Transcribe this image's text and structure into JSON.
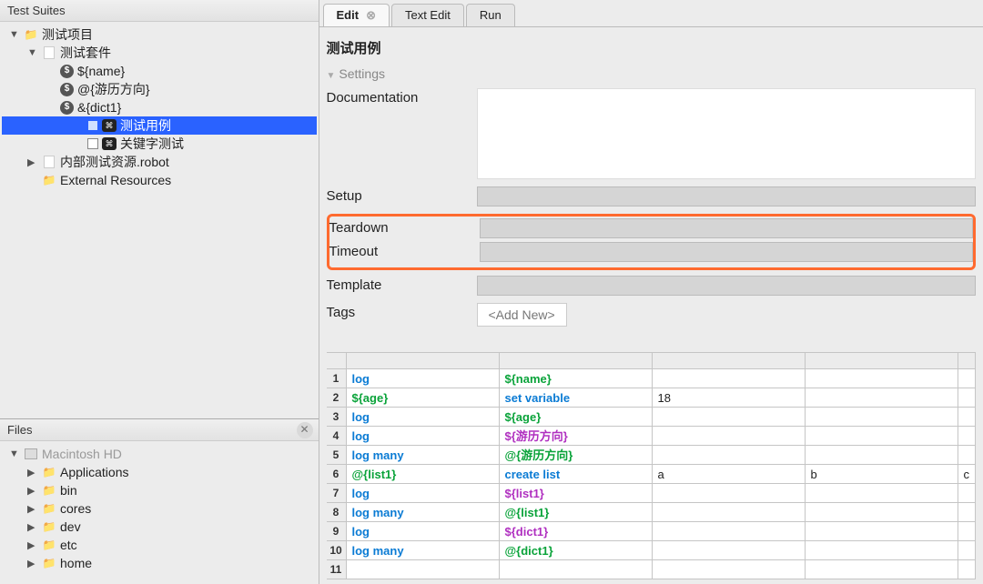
{
  "left": {
    "suites_title": "Test Suites",
    "files_title": "Files",
    "tree": [
      {
        "indent": 0,
        "expander": "▼",
        "icons": [
          "folder-open"
        ],
        "label": "测试项目"
      },
      {
        "indent": 1,
        "expander": "▼",
        "icons": [
          "file"
        ],
        "label": "测试套件"
      },
      {
        "indent": 2,
        "expander": "",
        "icons": [
          "var"
        ],
        "label": "${name}"
      },
      {
        "indent": 2,
        "expander": "",
        "icons": [
          "var"
        ],
        "label": "@{游历方向}"
      },
      {
        "indent": 2,
        "expander": "",
        "icons": [
          "var"
        ],
        "label": "&{dict1}"
      },
      {
        "indent": 2,
        "expander": "",
        "icons": [
          "checkbox",
          "kw"
        ],
        "label": "测试用例",
        "selected": true,
        "offset": true
      },
      {
        "indent": 2,
        "expander": "",
        "icons": [
          "checkbox",
          "kw"
        ],
        "label": "关键字测试",
        "offset": true
      },
      {
        "indent": 1,
        "expander": "▶",
        "icons": [
          "file"
        ],
        "label": "内部测试资源.robot"
      },
      {
        "indent": 1,
        "expander": "",
        "icons": [
          "folder-open"
        ],
        "label": "External Resources"
      }
    ],
    "files_tree": [
      {
        "indent": 0,
        "expander": "▼",
        "icons": [
          "disk"
        ],
        "label": "Macintosh HD",
        "grey": true
      },
      {
        "indent": 1,
        "expander": "▶",
        "icons": [
          "folder"
        ],
        "label": "Applications"
      },
      {
        "indent": 1,
        "expander": "▶",
        "icons": [
          "folder"
        ],
        "label": "bin"
      },
      {
        "indent": 1,
        "expander": "▶",
        "icons": [
          "folder"
        ],
        "label": "cores"
      },
      {
        "indent": 1,
        "expander": "▶",
        "icons": [
          "folder"
        ],
        "label": "dev"
      },
      {
        "indent": 1,
        "expander": "▶",
        "icons": [
          "folder"
        ],
        "label": "etc"
      },
      {
        "indent": 1,
        "expander": "▶",
        "icons": [
          "folder"
        ],
        "label": "home"
      }
    ]
  },
  "tabs": [
    {
      "label": "Edit",
      "active": true,
      "closable": true
    },
    {
      "label": "Text Edit",
      "active": false
    },
    {
      "label": "Run",
      "active": false
    }
  ],
  "editor": {
    "title": "测试用例",
    "settings_header": "Settings",
    "rows": {
      "documentation": "Documentation",
      "setup": "Setup",
      "teardown": "Teardown",
      "timeout": "Timeout",
      "template": "Template",
      "tags": "Tags"
    },
    "tags_placeholder": "<Add New>"
  },
  "grid": {
    "rows": [
      {
        "n": 1,
        "c": [
          {
            "t": "kw",
            "v": "log"
          },
          {
            "t": "var",
            "v": "${name}"
          },
          {
            "t": "",
            "v": ""
          },
          {
            "t": "",
            "v": ""
          },
          {
            "t": "",
            "v": ""
          }
        ]
      },
      {
        "n": 2,
        "c": [
          {
            "t": "var",
            "v": "${age}"
          },
          {
            "t": "kw",
            "v": "set variable"
          },
          {
            "t": "plain",
            "v": "18"
          },
          {
            "t": "",
            "v": ""
          },
          {
            "t": "",
            "v": ""
          }
        ]
      },
      {
        "n": 3,
        "c": [
          {
            "t": "kw",
            "v": "log"
          },
          {
            "t": "var",
            "v": "${age}"
          },
          {
            "t": "",
            "v": ""
          },
          {
            "t": "",
            "v": ""
          },
          {
            "t": "",
            "v": ""
          }
        ]
      },
      {
        "n": 4,
        "c": [
          {
            "t": "kw",
            "v": "log"
          },
          {
            "t": "dict",
            "v": "${游历方向}"
          },
          {
            "t": "",
            "v": ""
          },
          {
            "t": "",
            "v": ""
          },
          {
            "t": "",
            "v": ""
          }
        ]
      },
      {
        "n": 5,
        "c": [
          {
            "t": "kw",
            "v": "log many"
          },
          {
            "t": "var",
            "v": "@{游历方向}"
          },
          {
            "t": "",
            "v": ""
          },
          {
            "t": "",
            "v": ""
          },
          {
            "t": "",
            "v": ""
          }
        ]
      },
      {
        "n": 6,
        "c": [
          {
            "t": "var",
            "v": "@{list1}"
          },
          {
            "t": "kw",
            "v": "create list"
          },
          {
            "t": "plain",
            "v": "a"
          },
          {
            "t": "plain",
            "v": "b"
          },
          {
            "t": "plain",
            "v": "c"
          }
        ]
      },
      {
        "n": 7,
        "c": [
          {
            "t": "kw",
            "v": "log"
          },
          {
            "t": "dict",
            "v": "${list1}"
          },
          {
            "t": "",
            "v": ""
          },
          {
            "t": "",
            "v": ""
          },
          {
            "t": "",
            "v": ""
          }
        ]
      },
      {
        "n": 8,
        "c": [
          {
            "t": "kw",
            "v": "log many"
          },
          {
            "t": "var",
            "v": "@{list1}"
          },
          {
            "t": "",
            "v": ""
          },
          {
            "t": "",
            "v": ""
          },
          {
            "t": "",
            "v": ""
          }
        ]
      },
      {
        "n": 9,
        "c": [
          {
            "t": "kw",
            "v": "log"
          },
          {
            "t": "dict",
            "v": "${dict1}"
          },
          {
            "t": "",
            "v": ""
          },
          {
            "t": "",
            "v": ""
          },
          {
            "t": "",
            "v": ""
          }
        ]
      },
      {
        "n": 10,
        "c": [
          {
            "t": "kw",
            "v": "log many"
          },
          {
            "t": "var",
            "v": "@{dict1}"
          },
          {
            "t": "",
            "v": ""
          },
          {
            "t": "",
            "v": ""
          },
          {
            "t": "",
            "v": ""
          }
        ]
      },
      {
        "n": 11,
        "c": [
          {
            "t": "",
            "v": ""
          },
          {
            "t": "",
            "v": ""
          },
          {
            "t": "",
            "v": ""
          },
          {
            "t": "",
            "v": ""
          },
          {
            "t": "",
            "v": ""
          }
        ]
      }
    ]
  }
}
